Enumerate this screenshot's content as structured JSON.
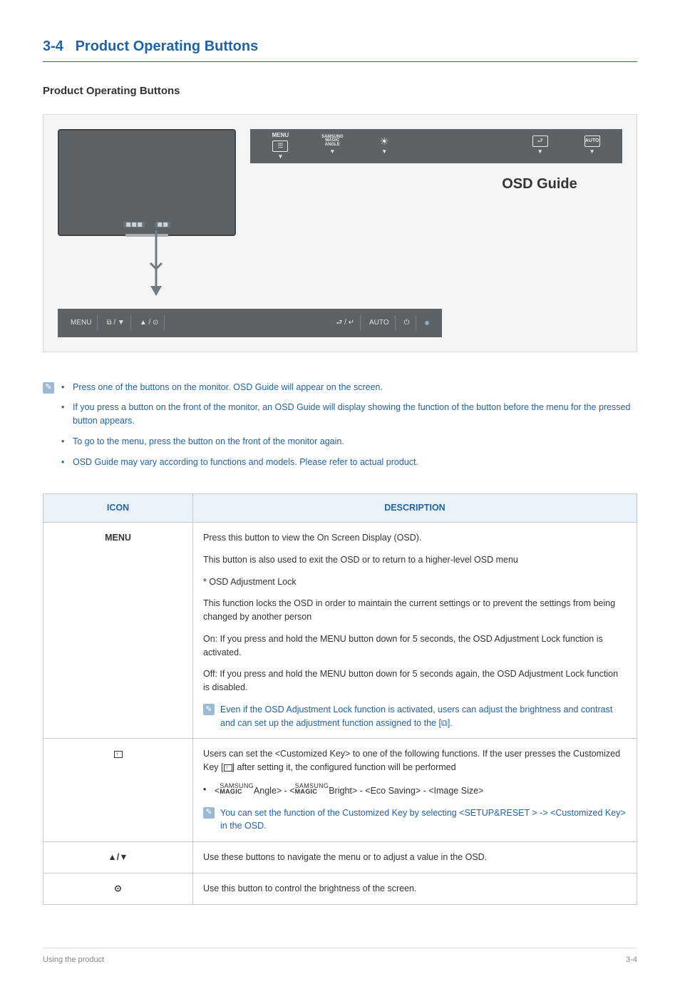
{
  "header": {
    "number": "3-4",
    "title": "Product Operating Buttons"
  },
  "subheader": "Product Operating Buttons",
  "osd_strip": {
    "cells": [
      {
        "top": "MENU",
        "icon": "menu-icon"
      },
      {
        "top": "SAMSUNG MAGIC ANGLE",
        "icon": "angle-icon"
      },
      {
        "top": "",
        "icon": "brightness-icon"
      },
      {
        "top": "",
        "icon": ""
      },
      {
        "top": "",
        "icon": ""
      },
      {
        "top": "",
        "icon": "source-icon"
      },
      {
        "top": "AUTO",
        "icon": "auto-icon"
      }
    ],
    "caption": "OSD Guide"
  },
  "button_strip": [
    "MENU",
    "⧉ / ▼",
    "▲ / ⊙",
    "",
    "⮐ / ↵",
    "AUTO",
    "⏻",
    "•"
  ],
  "bullets": [
    "Press one of the buttons on the monitor. OSD Guide will appear on the screen.",
    "If you press a button on the front of the monitor, an OSD Guide will display showing the function of the button before the menu for the pressed button appears.",
    "To go to the menu, press the button on the front of the monitor again.",
    "OSD Guide may vary according to functions and models. Please refer to actual product."
  ],
  "table": {
    "headers": {
      "icon": "ICON",
      "desc": "DESCRIPTION"
    },
    "rows": {
      "menu": {
        "icon_label": "MENU",
        "p1": "Press this button to view the On Screen Display (OSD).",
        "p2": "This button is also used to exit the OSD or to return to a higher-level OSD menu",
        "p3": "* OSD Adjustment Lock",
        "p4": "This function locks the OSD in order to maintain the current settings or to prevent the settings from being changed by another person",
        "p5": "On: If you press and hold the MENU button down for 5 seconds, the OSD Adjustment Lock function is activated.",
        "p6": "Off: If you press and hold the MENU button down for 5 seconds again, the OSD Adjustment Lock function is disabled.",
        "note": "Even if the OSD Adjustment Lock function is activated, users can adjust the brightness and contrast and can set up the adjustment function assigned to the [⧉]."
      },
      "custom": {
        "p1a": "Users can set the <Customized Key> to one of the following functions. If the user presses the Customized Key [",
        "p1b": "] after setting it, the configured function will be performed",
        "bullet_prefix": "<",
        "bullet_mid1": "Angle> - <",
        "bullet_mid2": "Bright> - <Eco Saving> - <Image Size>",
        "note": "You can set the function of the Customized Key by selecting <SETUP&RESET > -> <Customized Key> in the OSD."
      },
      "nav": {
        "icon_label": "▲/▼",
        "desc": "Use these buttons to navigate the menu or to adjust a value in the OSD."
      },
      "bright": {
        "icon_label": "⊙",
        "desc": "Use this button to control the brightness of the screen."
      }
    }
  },
  "footer": {
    "left": "Using the product",
    "right": "3-4"
  }
}
